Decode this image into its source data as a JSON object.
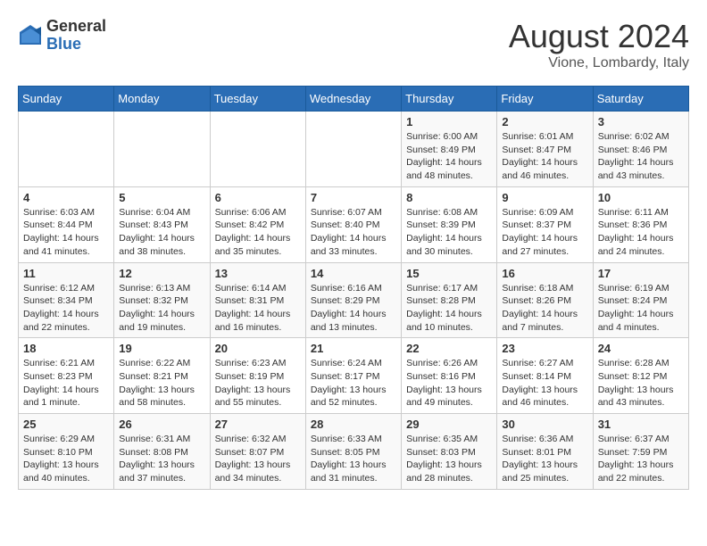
{
  "logo": {
    "general": "General",
    "blue": "Blue"
  },
  "title": "August 2024",
  "subtitle": "Vione, Lombardy, Italy",
  "days_header": [
    "Sunday",
    "Monday",
    "Tuesday",
    "Wednesday",
    "Thursday",
    "Friday",
    "Saturday"
  ],
  "weeks": [
    [
      {
        "day": "",
        "info": ""
      },
      {
        "day": "",
        "info": ""
      },
      {
        "day": "",
        "info": ""
      },
      {
        "day": "",
        "info": ""
      },
      {
        "day": "1",
        "info": "Sunrise: 6:00 AM\nSunset: 8:49 PM\nDaylight: 14 hours\nand 48 minutes."
      },
      {
        "day": "2",
        "info": "Sunrise: 6:01 AM\nSunset: 8:47 PM\nDaylight: 14 hours\nand 46 minutes."
      },
      {
        "day": "3",
        "info": "Sunrise: 6:02 AM\nSunset: 8:46 PM\nDaylight: 14 hours\nand 43 minutes."
      }
    ],
    [
      {
        "day": "4",
        "info": "Sunrise: 6:03 AM\nSunset: 8:44 PM\nDaylight: 14 hours\nand 41 minutes."
      },
      {
        "day": "5",
        "info": "Sunrise: 6:04 AM\nSunset: 8:43 PM\nDaylight: 14 hours\nand 38 minutes."
      },
      {
        "day": "6",
        "info": "Sunrise: 6:06 AM\nSunset: 8:42 PM\nDaylight: 14 hours\nand 35 minutes."
      },
      {
        "day": "7",
        "info": "Sunrise: 6:07 AM\nSunset: 8:40 PM\nDaylight: 14 hours\nand 33 minutes."
      },
      {
        "day": "8",
        "info": "Sunrise: 6:08 AM\nSunset: 8:39 PM\nDaylight: 14 hours\nand 30 minutes."
      },
      {
        "day": "9",
        "info": "Sunrise: 6:09 AM\nSunset: 8:37 PM\nDaylight: 14 hours\nand 27 minutes."
      },
      {
        "day": "10",
        "info": "Sunrise: 6:11 AM\nSunset: 8:36 PM\nDaylight: 14 hours\nand 24 minutes."
      }
    ],
    [
      {
        "day": "11",
        "info": "Sunrise: 6:12 AM\nSunset: 8:34 PM\nDaylight: 14 hours\nand 22 minutes."
      },
      {
        "day": "12",
        "info": "Sunrise: 6:13 AM\nSunset: 8:32 PM\nDaylight: 14 hours\nand 19 minutes."
      },
      {
        "day": "13",
        "info": "Sunrise: 6:14 AM\nSunset: 8:31 PM\nDaylight: 14 hours\nand 16 minutes."
      },
      {
        "day": "14",
        "info": "Sunrise: 6:16 AM\nSunset: 8:29 PM\nDaylight: 14 hours\nand 13 minutes."
      },
      {
        "day": "15",
        "info": "Sunrise: 6:17 AM\nSunset: 8:28 PM\nDaylight: 14 hours\nand 10 minutes."
      },
      {
        "day": "16",
        "info": "Sunrise: 6:18 AM\nSunset: 8:26 PM\nDaylight: 14 hours\nand 7 minutes."
      },
      {
        "day": "17",
        "info": "Sunrise: 6:19 AM\nSunset: 8:24 PM\nDaylight: 14 hours\nand 4 minutes."
      }
    ],
    [
      {
        "day": "18",
        "info": "Sunrise: 6:21 AM\nSunset: 8:23 PM\nDaylight: 14 hours\nand 1 minute."
      },
      {
        "day": "19",
        "info": "Sunrise: 6:22 AM\nSunset: 8:21 PM\nDaylight: 13 hours\nand 58 minutes."
      },
      {
        "day": "20",
        "info": "Sunrise: 6:23 AM\nSunset: 8:19 PM\nDaylight: 13 hours\nand 55 minutes."
      },
      {
        "day": "21",
        "info": "Sunrise: 6:24 AM\nSunset: 8:17 PM\nDaylight: 13 hours\nand 52 minutes."
      },
      {
        "day": "22",
        "info": "Sunrise: 6:26 AM\nSunset: 8:16 PM\nDaylight: 13 hours\nand 49 minutes."
      },
      {
        "day": "23",
        "info": "Sunrise: 6:27 AM\nSunset: 8:14 PM\nDaylight: 13 hours\nand 46 minutes."
      },
      {
        "day": "24",
        "info": "Sunrise: 6:28 AM\nSunset: 8:12 PM\nDaylight: 13 hours\nand 43 minutes."
      }
    ],
    [
      {
        "day": "25",
        "info": "Sunrise: 6:29 AM\nSunset: 8:10 PM\nDaylight: 13 hours\nand 40 minutes."
      },
      {
        "day": "26",
        "info": "Sunrise: 6:31 AM\nSunset: 8:08 PM\nDaylight: 13 hours\nand 37 minutes."
      },
      {
        "day": "27",
        "info": "Sunrise: 6:32 AM\nSunset: 8:07 PM\nDaylight: 13 hours\nand 34 minutes."
      },
      {
        "day": "28",
        "info": "Sunrise: 6:33 AM\nSunset: 8:05 PM\nDaylight: 13 hours\nand 31 minutes."
      },
      {
        "day": "29",
        "info": "Sunrise: 6:35 AM\nSunset: 8:03 PM\nDaylight: 13 hours\nand 28 minutes."
      },
      {
        "day": "30",
        "info": "Sunrise: 6:36 AM\nSunset: 8:01 PM\nDaylight: 13 hours\nand 25 minutes."
      },
      {
        "day": "31",
        "info": "Sunrise: 6:37 AM\nSunset: 7:59 PM\nDaylight: 13 hours\nand 22 minutes."
      }
    ]
  ]
}
